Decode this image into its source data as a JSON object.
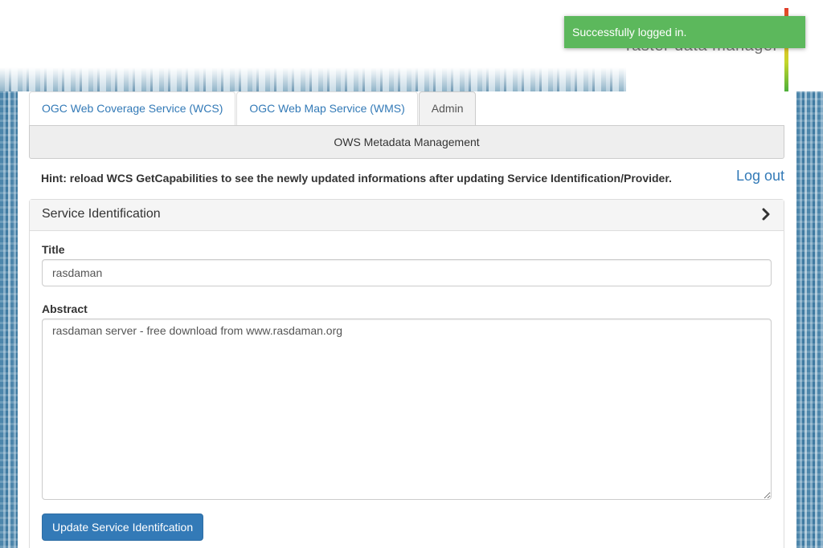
{
  "header": {
    "logo_text": "raster data manager"
  },
  "toast": {
    "message": "Successfully logged in.",
    "color": "#5cb85c"
  },
  "tabs": [
    {
      "label": "OGC Web Coverage Service (WCS)",
      "active": false
    },
    {
      "label": "OGC Web Map Service (WMS)",
      "active": false
    },
    {
      "label": "Admin",
      "active": true
    }
  ],
  "subnav": {
    "label": "OWS Metadata Management"
  },
  "hint": {
    "text": "Hint: reload WCS GetCapabilities to see the newly updated informations after updating Service Identification/Provider."
  },
  "logout": {
    "label": "Log out"
  },
  "panel": {
    "title": "Service Identification",
    "chevron_icon": "chevron-right-icon",
    "title_field": {
      "label": "Title",
      "value": "rasdaman"
    },
    "abstract_field": {
      "label": "Abstract",
      "value": "rasdaman server - free download from www.rasdaman.org"
    },
    "update_button": "Update Service Identifcation"
  },
  "colors": {
    "primary": "#337ab7",
    "link": "#337ab7",
    "success": "#5cb85c"
  }
}
